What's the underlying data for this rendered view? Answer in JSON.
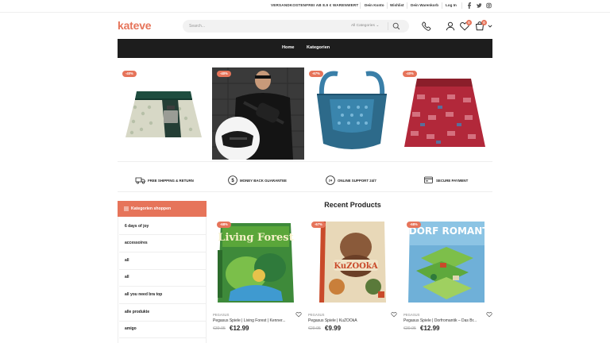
{
  "topbar": {
    "promo": "VERSANDKOSTENFREI AB 8.9 € WARENWERT",
    "links": [
      "Dein Konto",
      "Wishlist",
      "Dein Warenkorb",
      "Log In"
    ],
    "social": [
      "facebook-icon",
      "twitter-icon",
      "instagram-icon"
    ]
  },
  "header": {
    "logo": "kateve",
    "search_placeholder": "Search...",
    "category_select": "All Categories",
    "wishlist_count": "0",
    "cart_count": "0"
  },
  "nav": {
    "items": [
      "Home",
      "Kategorien"
    ]
  },
  "banner": {
    "tiles": [
      {
        "discount": "-40%",
        "alt": "green wrap skirt"
      },
      {
        "discount": "-40%",
        "alt": "black belt bag"
      },
      {
        "discount": "-67%",
        "alt": "blue shoulder bag"
      },
      {
        "discount": "-40%",
        "alt": "red patterned skirt"
      }
    ]
  },
  "features": [
    {
      "icon": "truck-icon",
      "label": "FREE SHIPPING & RETURN"
    },
    {
      "icon": "money-icon",
      "label": "MONEY BACK GUARANTEE"
    },
    {
      "icon": "support-icon",
      "label": "ONLINE SUPPORT 24/7"
    },
    {
      "icon": "card-icon",
      "label": "SECURE PAYMENT"
    }
  ],
  "sidebar": {
    "title": "Kategorien shoppen",
    "items": [
      "6 days of joy",
      "accessoires",
      "all",
      "all",
      "all you need bra top",
      "alle produkte",
      "amigo"
    ]
  },
  "recent": {
    "title": "Recent Products",
    "products": [
      {
        "discount": "-68%",
        "brand": "PEGASUS",
        "name": "Pegasus Spiele | Living Forest | Kenner...",
        "old_price": "€39.95",
        "price": "€12.99",
        "box_title": "Living Forest"
      },
      {
        "discount": "-67%",
        "brand": "PEGASUS",
        "name": "Pegasus Spiele | KuZOOkA",
        "old_price": "€29.95",
        "price": "€9.99",
        "box_title": "KuZOOkA"
      },
      {
        "discount": "-68%",
        "brand": "PEGASUS",
        "name": "Pegasus Spiele | Dorfromantik – Das Br...",
        "old_price": "€39.95",
        "price": "€12.99",
        "box_title": "DORF ROMANTIK"
      }
    ]
  },
  "colors": {
    "accent": "#e6745a",
    "nav": "#1d1d1d"
  }
}
